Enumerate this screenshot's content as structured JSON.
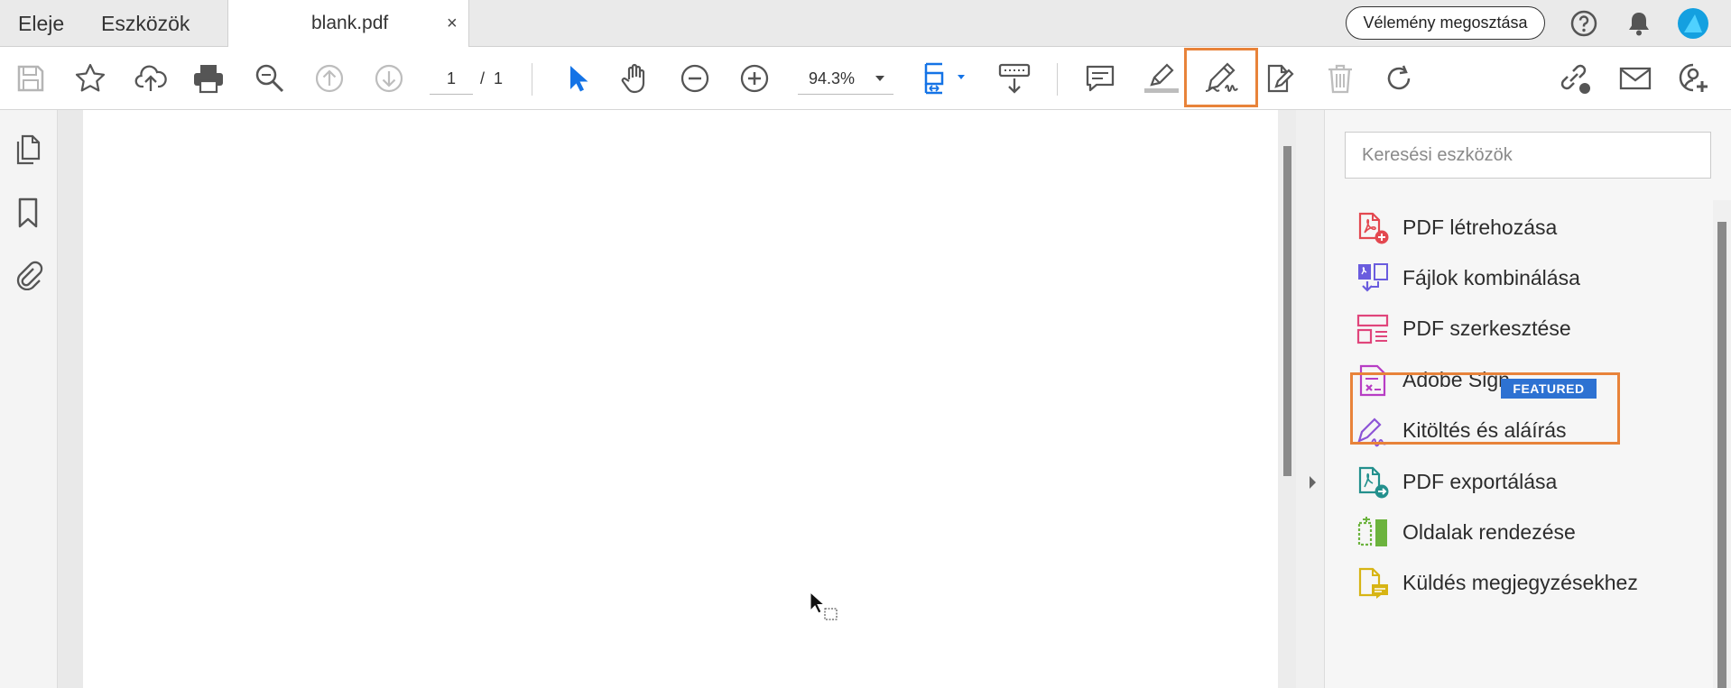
{
  "tabs": {
    "home": "Eleje",
    "tools": "Eszközök",
    "document": "blank.pdf",
    "close": "×"
  },
  "header": {
    "feedback_label": "Vélemény megosztása"
  },
  "toolbar": {
    "page_current": "1",
    "page_separator": "/",
    "page_total": "1",
    "zoom": "94.3%"
  },
  "right_pane": {
    "search_placeholder": "Keresési eszközök",
    "featured_badge": "FEATURED",
    "tools": [
      {
        "label": "PDF létrehozása",
        "icon": "create-pdf-icon",
        "color": "#e34850"
      },
      {
        "label": "Fájlok kombinálása",
        "icon": "combine-files-icon",
        "color": "#6a5cde"
      },
      {
        "label": "PDF szerkesztése",
        "icon": "edit-pdf-icon",
        "color": "#e0457b"
      },
      {
        "label": "Adobe Sign",
        "icon": "adobe-sign-icon",
        "color": "#b73dc4"
      },
      {
        "label": "Kitöltés és aláírás",
        "icon": "fill-sign-icon",
        "color": "#8c54d6"
      },
      {
        "label": "PDF exportálása",
        "icon": "export-pdf-icon",
        "color": "#23908d"
      },
      {
        "label": "Oldalak rendezése",
        "icon": "organize-pages-icon",
        "color": "#6cb33e"
      },
      {
        "label": "Küldés megjegyzésekhez",
        "icon": "send-comments-icon",
        "color": "#d7b414"
      }
    ]
  },
  "colors": {
    "highlight": "#e8833a",
    "accent_blue": "#1473e6",
    "featured_badge": "#2d72d2"
  }
}
